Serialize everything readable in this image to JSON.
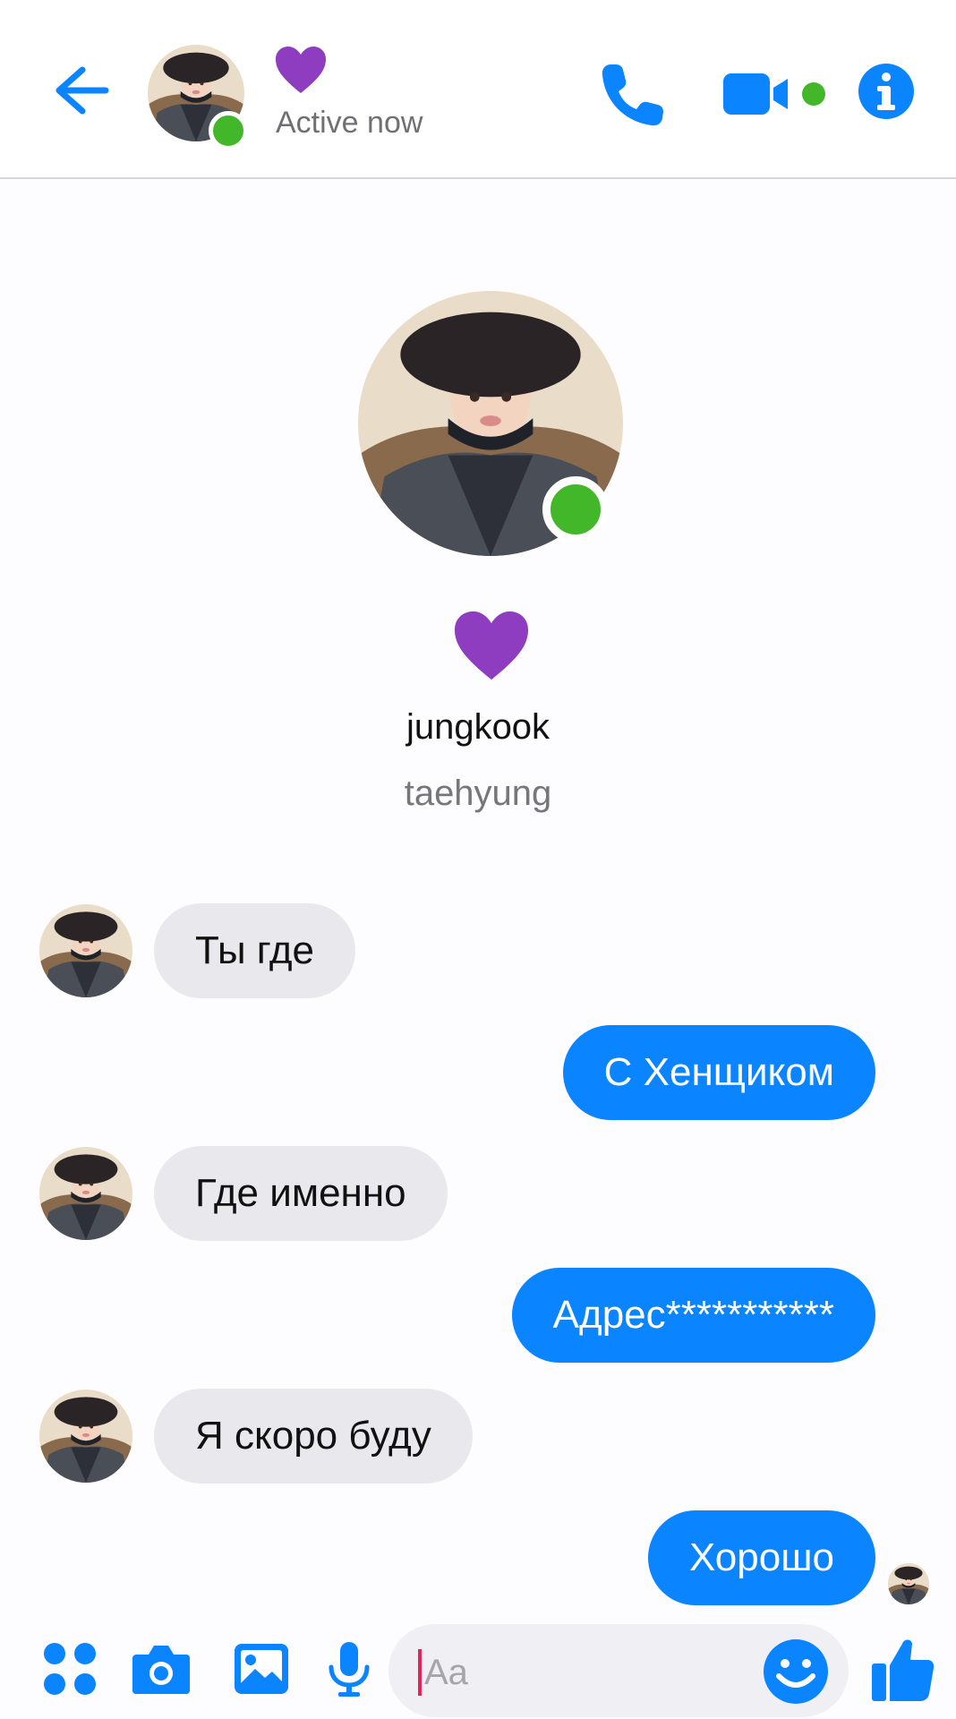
{
  "header": {
    "title_emoji": "💜",
    "status": "Active now"
  },
  "profile": {
    "emoji": "💜",
    "name": "jungkook",
    "nickname": "taehyung"
  },
  "messages": [
    {
      "direction": "in",
      "text": "Ты где"
    },
    {
      "direction": "out",
      "text": "С Хенщиком"
    },
    {
      "direction": "in",
      "text": "Где именно"
    },
    {
      "direction": "out",
      "text": "Адрес***********"
    },
    {
      "direction": "in",
      "text": "Я скоро буду"
    },
    {
      "direction": "out",
      "text": "Хорошо"
    }
  ],
  "composer": {
    "placeholder": "Aa",
    "value": ""
  },
  "icons": {
    "back": "back-arrow-icon",
    "call": "phone-icon",
    "video": "video-camera-icon",
    "info": "info-icon",
    "apps": "apps-grid-icon",
    "camera": "camera-icon",
    "gallery": "image-icon",
    "mic": "microphone-icon",
    "emoji": "smiley-icon",
    "like": "thumbs-up-icon"
  },
  "colors": {
    "accent": "#0a84ff",
    "online": "#42b72a",
    "heart": "#8e3cc0",
    "incoming_bubble": "#e9e8ec",
    "caret": "#e0245e"
  }
}
